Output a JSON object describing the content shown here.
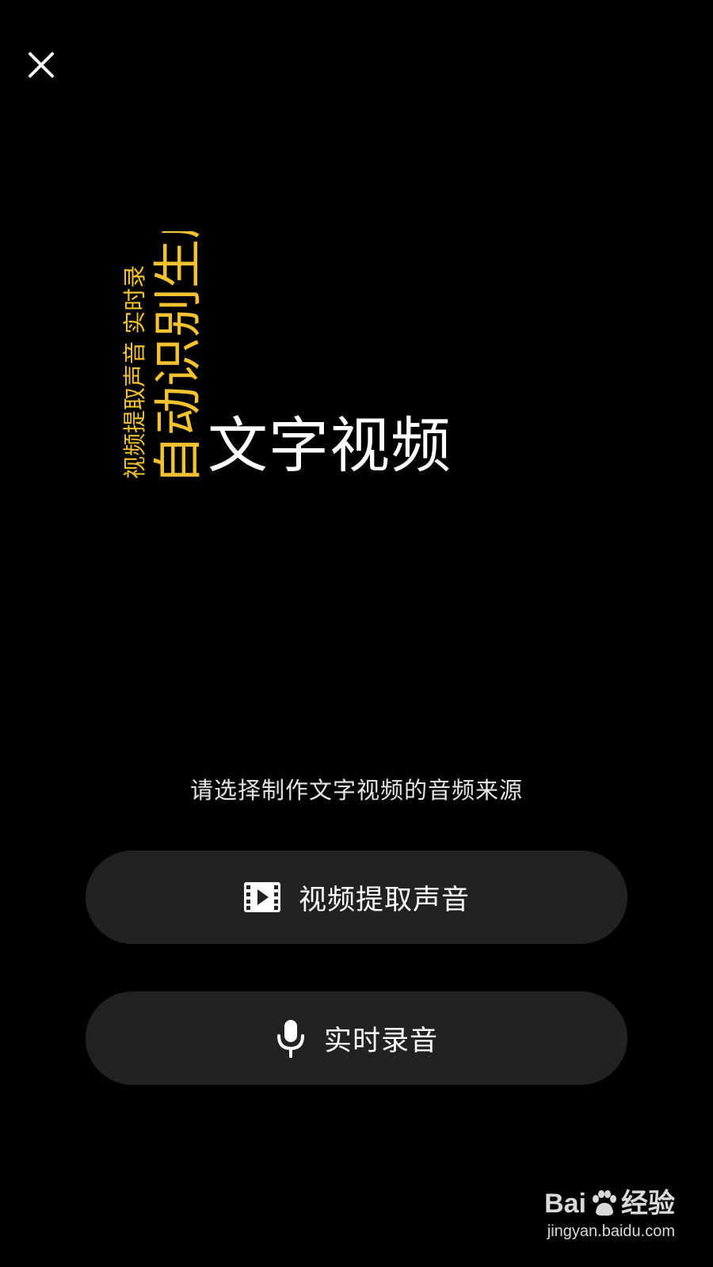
{
  "header": {
    "close_icon": "close-icon"
  },
  "hero": {
    "vertical_small": "视频提取声音 实时录",
    "vertical_large": "自动识别生成",
    "title": "文字视频",
    "accent_color": "#f2c230"
  },
  "prompt": "请选择制作文字视频的音频来源",
  "options": [
    {
      "label": "视频提取声音",
      "icon": "video-film-icon"
    },
    {
      "label": "实时录音",
      "icon": "microphone-icon"
    }
  ],
  "watermark": {
    "logo_text_a": "Bai",
    "logo_text_b": "经验",
    "url": "jingyan.baidu.com"
  }
}
